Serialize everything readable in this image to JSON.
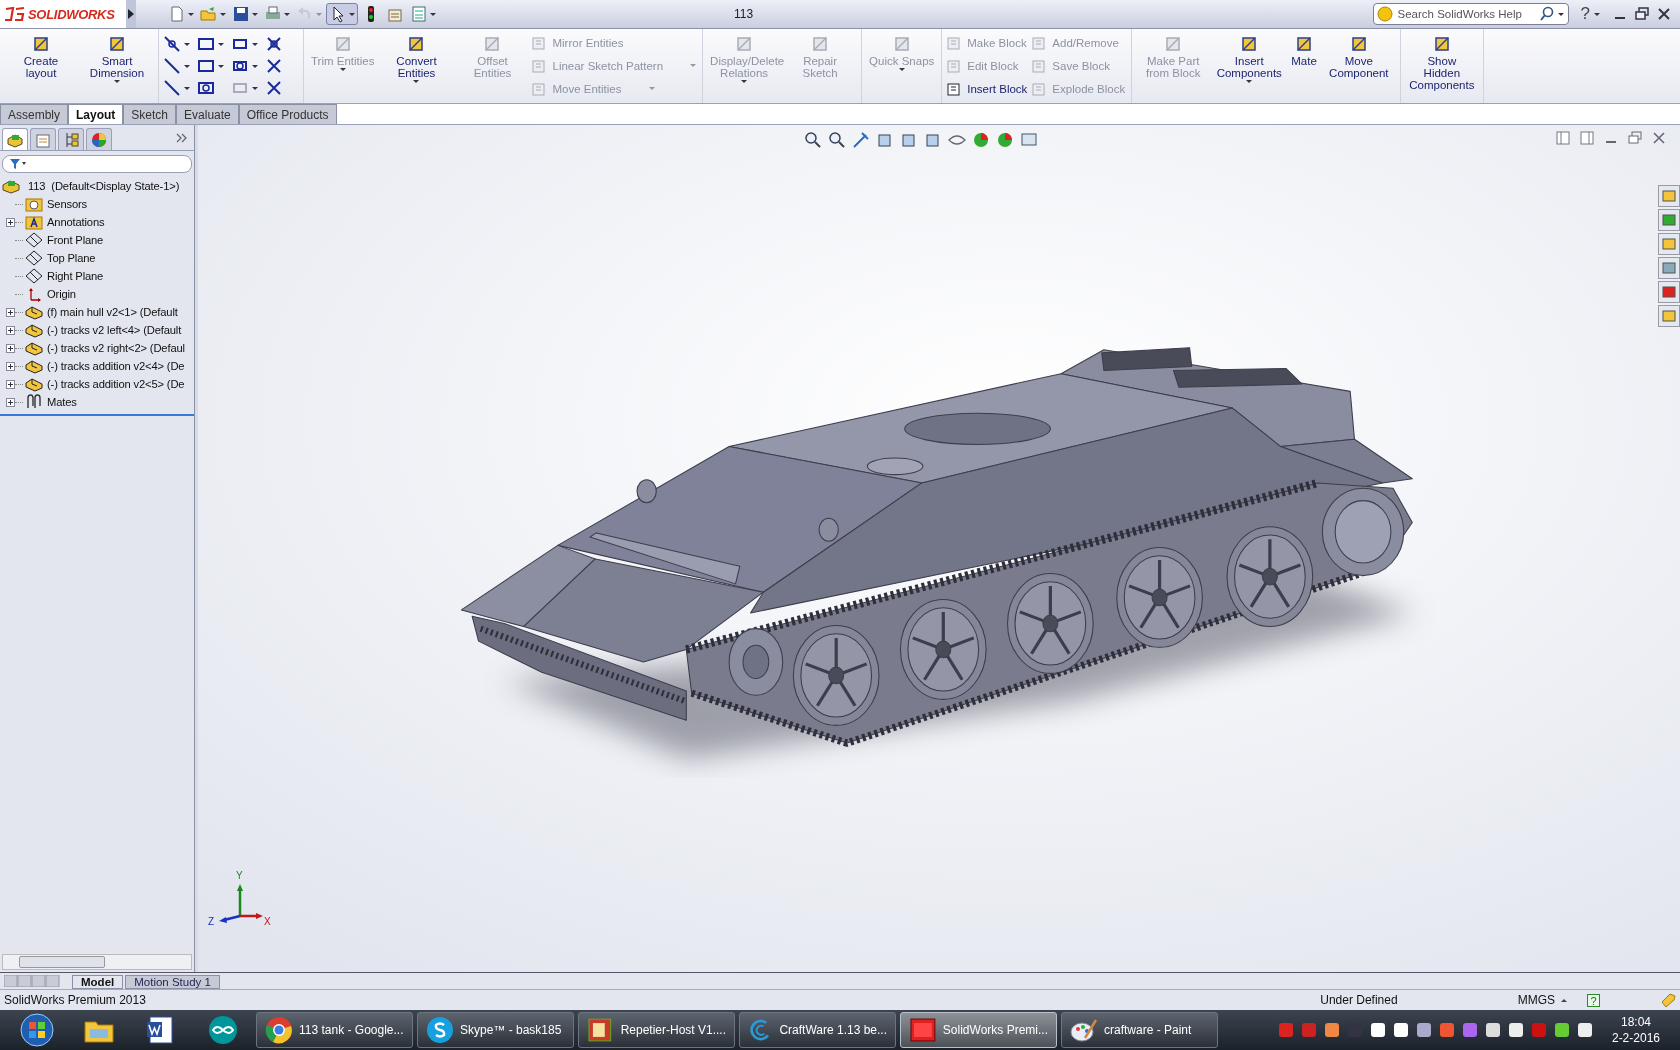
{
  "app": {
    "logo": "SOLIDWORKS",
    "title": "113",
    "search": {
      "placeholder": "Search SolidWorks Help"
    },
    "help": "?"
  },
  "quick_access": [
    {
      "kind": "new",
      "dropdown": true,
      "disabled": false,
      "selected": false
    },
    {
      "kind": "open",
      "dropdown": true,
      "disabled": false,
      "selected": false
    },
    {
      "kind": "save",
      "dropdown": true,
      "disabled": false,
      "selected": false
    },
    {
      "kind": "print",
      "dropdown": true,
      "disabled": false,
      "selected": false
    },
    {
      "kind": "undo",
      "dropdown": true,
      "disabled": true,
      "selected": false
    },
    {
      "kind": "select",
      "dropdown": true,
      "disabled": false,
      "selected": true
    },
    {
      "kind": "rebuild",
      "dropdown": false,
      "disabled": false,
      "selected": false
    },
    {
      "kind": "options",
      "dropdown": false,
      "disabled": false,
      "selected": false
    },
    {
      "kind": "properties",
      "dropdown": true,
      "disabled": false,
      "selected": false
    }
  ],
  "ribbon": {
    "groups": [
      {
        "columns": [
          {
            "kind": "large",
            "items": [
              {
                "label": "Create layout",
                "disabled": false,
                "dropdown": false
              }
            ]
          },
          {
            "kind": "large",
            "items": [
              {
                "label": "Smart Dimension",
                "disabled": false,
                "dropdown": true
              }
            ]
          }
        ]
      },
      {
        "columns": [
          {
            "kind": "tools",
            "items": [
              {
                "dropdown": true,
                "disabled": false
              },
              {
                "dropdown": true,
                "disabled": false
              },
              {
                "dropdown": true,
                "disabled": false
              },
              {
                "dropdown": false,
                "disabled": false
              },
              {
                "dropdown": true,
                "disabled": false
              },
              {
                "dropdown": true,
                "disabled": false
              },
              {
                "dropdown": true,
                "disabled": false
              },
              {
                "dropdown": false,
                "disabled": false
              },
              {
                "dropdown": true,
                "disabled": false
              },
              {
                "dropdown": false,
                "disabled": false
              },
              {
                "dropdown": true,
                "disabled": true
              },
              {
                "dropdown": false,
                "disabled": false
              }
            ]
          }
        ]
      },
      {
        "columns": [
          {
            "kind": "large",
            "items": [
              {
                "label": "Trim Entities",
                "disabled": true,
                "dropdown": true
              }
            ]
          },
          {
            "kind": "large",
            "items": [
              {
                "label": "Convert Entities",
                "disabled": false,
                "dropdown": true
              }
            ]
          },
          {
            "kind": "large",
            "items": [
              {
                "label": "Offset Entities",
                "disabled": true,
                "dropdown": false
              }
            ]
          },
          {
            "kind": "small",
            "items": [
              {
                "label": "Mirror Entities",
                "disabled": true,
                "dropdown": false
              },
              {
                "label": "Linear Sketch Pattern",
                "disabled": true,
                "dropdown": true
              },
              {
                "label": "Move Entities",
                "disabled": true,
                "dropdown": true
              }
            ]
          }
        ]
      },
      {
        "columns": [
          {
            "kind": "large",
            "items": [
              {
                "label": "Display/Delete Relations",
                "disabled": true,
                "dropdown": true
              }
            ]
          },
          {
            "kind": "large",
            "items": [
              {
                "label": "Repair Sketch",
                "disabled": true,
                "dropdown": false
              }
            ]
          }
        ]
      },
      {
        "columns": [
          {
            "kind": "large",
            "items": [
              {
                "label": "Quick Snaps",
                "disabled": true,
                "dropdown": true
              }
            ]
          }
        ]
      },
      {
        "columns": [
          {
            "kind": "small",
            "items": [
              {
                "label": "Make Block",
                "disabled": true,
                "dropdown": false
              },
              {
                "label": "Edit Block",
                "disabled": true,
                "dropdown": false
              },
              {
                "label": "Insert Block",
                "disabled": false,
                "dropdown": false
              }
            ]
          },
          {
            "kind": "small",
            "items": [
              {
                "label": "Add/Remove",
                "disabled": true,
                "dropdown": false
              },
              {
                "label": "Save Block",
                "disabled": true,
                "dropdown": false
              },
              {
                "label": "Explode Block",
                "disabled": true,
                "dropdown": false
              }
            ]
          }
        ]
      },
      {
        "columns": [
          {
            "kind": "large",
            "items": [
              {
                "label": "Make Part from Block",
                "disabled": true,
                "dropdown": false
              }
            ]
          },
          {
            "kind": "large",
            "items": [
              {
                "label": "Insert Components",
                "disabled": false,
                "dropdown": true
              }
            ]
          },
          {
            "kind": "large",
            "items": [
              {
                "label": "Mate",
                "disabled": false,
                "dropdown": false
              }
            ]
          },
          {
            "kind": "large",
            "items": [
              {
                "label": "Move Component",
                "disabled": false,
                "dropdown": false
              }
            ]
          }
        ]
      },
      {
        "columns": [
          {
            "kind": "large",
            "items": [
              {
                "label": "Show Hidden Components",
                "disabled": false,
                "dropdown": false
              }
            ]
          }
        ]
      }
    ]
  },
  "command_tabs": [
    {
      "label": "Assembly",
      "selected": false
    },
    {
      "label": "Layout",
      "selected": true
    },
    {
      "label": "Sketch",
      "selected": false
    },
    {
      "label": "Evaluate",
      "selected": false
    },
    {
      "label": "Office Products",
      "selected": false
    }
  ],
  "panel_tabs": [
    {
      "kind": "tree",
      "selected": true
    },
    {
      "kind": "properties",
      "selected": false
    },
    {
      "kind": "config",
      "selected": false
    },
    {
      "kind": "display",
      "selected": false
    }
  ],
  "tree": {
    "label": "113  (Default<Display State-1>)",
    "kind": "assembly",
    "children": [
      {
        "label": "Sensors",
        "kind": "sensors",
        "expandable": false
      },
      {
        "label": "Annotations",
        "kind": "annotations",
        "expandable": true
      },
      {
        "label": "Front Plane",
        "kind": "plane",
        "expandable": false
      },
      {
        "label": "Top Plane",
        "kind": "plane",
        "expandable": false
      },
      {
        "label": "Right Plane",
        "kind": "plane",
        "expandable": false
      },
      {
        "label": "Origin",
        "kind": "origin",
        "expandable": false
      },
      {
        "label": "(f) main hull v2<1> (Default",
        "kind": "component",
        "expandable": true
      },
      {
        "label": "(-) tracks v2 left<4> (Default",
        "kind": "component",
        "expandable": true
      },
      {
        "label": "(-) tracks v2 right<2> (Defaul",
        "kind": "component",
        "expandable": true
      },
      {
        "label": "(-) tracks addition v2<4> (De",
        "kind": "component",
        "expandable": true
      },
      {
        "label": "(-) tracks addition v2<5> (De",
        "kind": "component",
        "expandable": true
      },
      {
        "label": "Mates",
        "kind": "mates",
        "expandable": true
      }
    ]
  },
  "axes": {
    "y": "Y",
    "z": "Z",
    "x": "X"
  },
  "bottom_tabs": [
    {
      "label": "Model",
      "selected": true
    },
    {
      "label": "Motion Study 1",
      "selected": false
    }
  ],
  "status_bar": {
    "product": "SolidWorks Premium 2013",
    "state": "Under Defined",
    "units": "MMGS",
    "help": "?"
  },
  "taskbar": {
    "pinned": [
      {
        "kind": "start"
      },
      {
        "kind": "explorer"
      },
      {
        "kind": "word"
      },
      {
        "kind": "arduino"
      }
    ],
    "windows": [
      {
        "label": "113 tank - Google...",
        "kind": "chrome",
        "selected": false
      },
      {
        "label": "Skype™ - bask185",
        "kind": "skype",
        "selected": false
      },
      {
        "label": "Repetier-Host V1....",
        "kind": "repetier",
        "selected": false
      },
      {
        "label": "CraftWare 1.13 be...",
        "kind": "craftware",
        "selected": false
      },
      {
        "label": "SolidWorks Premi...",
        "kind": "solidworks",
        "selected": true
      },
      {
        "label": "craftware - Paint",
        "kind": "paint",
        "selected": false
      }
    ],
    "time": "18:04",
    "date": "2-2-2016"
  }
}
